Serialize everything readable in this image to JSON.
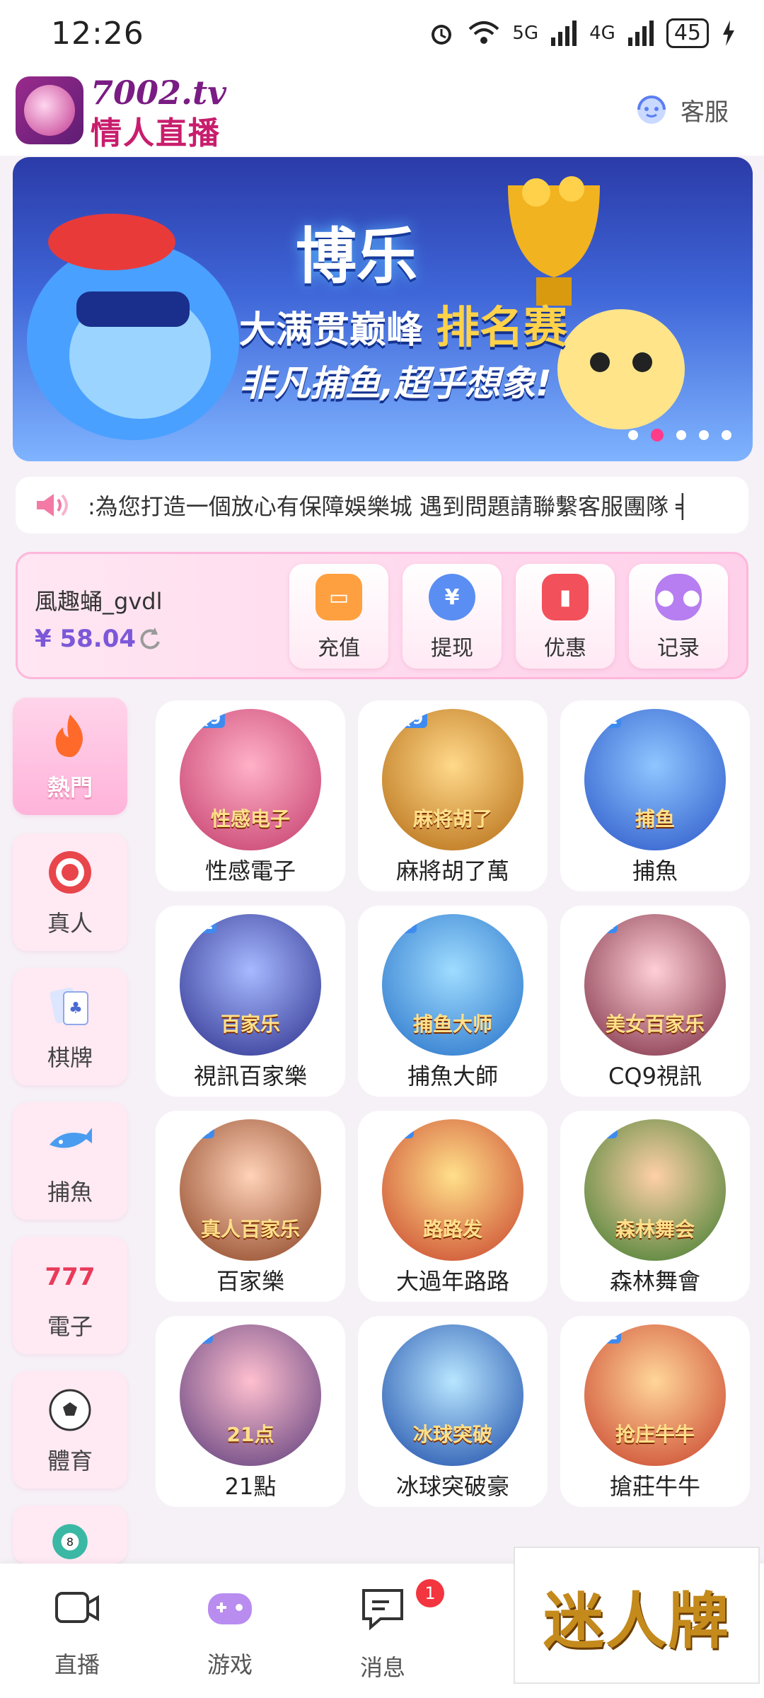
{
  "status_bar": {
    "time": "12:26",
    "network1": "5G",
    "network2": "4G",
    "battery": "45"
  },
  "header": {
    "brand_top": "7002.tv",
    "brand_bottom": "情人直播",
    "service_label": "客服"
  },
  "banner": {
    "title": "博乐",
    "line1_a": "大满贯巅峰",
    "line1_b": "排名赛",
    "line2": "非凡捕鱼,超乎想象!",
    "slides": 5,
    "active_slide": 2
  },
  "notice": {
    "text": ":為您打造一個放心有保障娛樂城  遇到問題請聯繫客服團隊 ╡"
  },
  "wallet": {
    "username": "風趣蛹_gvdl",
    "balance": "¥ 58.04",
    "buttons": [
      {
        "label": "充值",
        "icon": "wallet-icon",
        "color": "#ffa040"
      },
      {
        "label": "提现",
        "icon": "yen-coin-icon",
        "color": "#5a8ef2"
      },
      {
        "label": "优惠",
        "icon": "ticket-icon",
        "color": "#f2505a"
      },
      {
        "label": "记录",
        "icon": "gamepad-icon",
        "color": "#b67ef0"
      }
    ]
  },
  "sidebar": [
    {
      "label": "熱門",
      "icon": "flame-icon",
      "active": true
    },
    {
      "label": "真人",
      "icon": "poker-chip-icon",
      "active": false
    },
    {
      "label": "棋牌",
      "icon": "cards-icon",
      "active": false
    },
    {
      "label": "捕魚",
      "icon": "shark-icon",
      "active": false
    },
    {
      "label": "電子",
      "icon": "slot-777-icon",
      "active": false
    },
    {
      "label": "體育",
      "icon": "soccer-ball-icon",
      "active": false
    },
    {
      "label": "",
      "icon": "lottery-ball-icon",
      "active": false
    }
  ],
  "games": [
    {
      "name": "性感電子",
      "badge": "CQ9",
      "caption": "性感电子"
    },
    {
      "name": "麻將胡了萬",
      "badge": "CQ9",
      "caption": "麻将胡了"
    },
    {
      "name": "捕魚",
      "badge": "WL",
      "caption": "捕鱼"
    },
    {
      "name": "視訊百家樂",
      "badge": "WL",
      "caption": "百家乐"
    },
    {
      "name": "捕魚大師",
      "badge": "AG",
      "caption": "捕鱼大师"
    },
    {
      "name": "CQ9視訊",
      "badge": "mt",
      "caption": "美女百家乐"
    },
    {
      "name": "百家樂",
      "badge": "AG",
      "caption": "真人百家乐"
    },
    {
      "name": "大過年路路",
      "badge": "FC",
      "caption": "路路发"
    },
    {
      "name": "森林舞會",
      "badge": "KY",
      "caption": "森林舞会"
    },
    {
      "name": "21點",
      "badge": "KY",
      "caption": "21点"
    },
    {
      "name": "冰球突破豪",
      "badge": "M",
      "caption": "冰球突破"
    },
    {
      "name": "搶莊牛牛",
      "badge": "WL",
      "caption": "抢庄牛牛"
    }
  ],
  "tabbar": [
    {
      "label": "直播",
      "icon": "video-camera-icon"
    },
    {
      "label": "游戏",
      "icon": "gamepad-icon"
    },
    {
      "label": "消息",
      "icon": "message-icon",
      "badge": "1"
    }
  ],
  "float_ad": {
    "text": "迷人牌"
  }
}
